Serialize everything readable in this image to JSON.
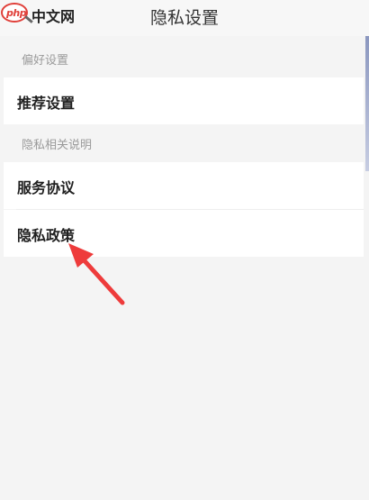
{
  "header": {
    "title": "隐私设置"
  },
  "watermark": {
    "badge": "php",
    "text": "中文网"
  },
  "sections": [
    {
      "header": "偏好设置",
      "items": [
        "推荐设置"
      ]
    },
    {
      "header": "隐私相关说明",
      "items": [
        "服务协议",
        "隐私政策"
      ]
    }
  ],
  "colors": {
    "arrow": "#ee3b3b",
    "row_bg": "#ffffff",
    "page_bg": "#f4f4f4",
    "section_text": "#9a9a9a"
  }
}
